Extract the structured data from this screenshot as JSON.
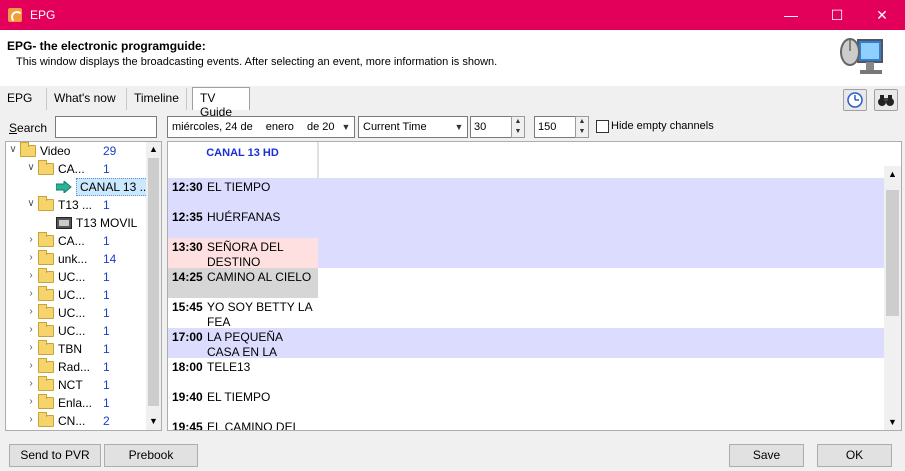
{
  "window": {
    "title": "EPG",
    "minimize": "—",
    "maximize": "☐",
    "close": "✕"
  },
  "header": {
    "title": "EPG- the electronic programguide:",
    "subtitle": "This window displays the broadcasting events. After selecting an event, more information is shown."
  },
  "tabs": [
    "EPG",
    "What's now",
    "Timeline",
    "TV Guide"
  ],
  "active_tab": "TV Guide",
  "toolbar": {
    "search_label": "Search",
    "search_value": "",
    "date_day": "miércoles, 24 de",
    "date_month": "enero",
    "date_year": "de 20",
    "time_mode": "Current Time",
    "spin1": "30",
    "spin2": "150",
    "hide_empty_label": "Hide empty channels"
  },
  "tree": [
    {
      "label": "Video",
      "count": "29",
      "level": 0,
      "icon": "folder-open-icon",
      "expanded": true
    },
    {
      "label": "CA...",
      "count": "1",
      "level": 1,
      "icon": "folder-open-icon",
      "expanded": true
    },
    {
      "label": "CANAL 13 ...",
      "count": "",
      "level": 2,
      "icon": "channel-arrow-icon",
      "selected": true
    },
    {
      "label": "T13 ...",
      "count": "1",
      "level": 1,
      "icon": "folder-open-icon",
      "expanded": true
    },
    {
      "label": "T13 MOVIL",
      "count": "",
      "level": 2,
      "icon": "film-icon"
    },
    {
      "label": "CA...",
      "count": "1",
      "level": 1,
      "icon": "folder-icon"
    },
    {
      "label": "unk...",
      "count": "14",
      "level": 1,
      "icon": "folder-icon"
    },
    {
      "label": "UC...",
      "count": "1",
      "level": 1,
      "icon": "folder-icon"
    },
    {
      "label": "UC...",
      "count": "1",
      "level": 1,
      "icon": "folder-icon"
    },
    {
      "label": "UC...",
      "count": "1",
      "level": 1,
      "icon": "folder-icon"
    },
    {
      "label": "UC...",
      "count": "1",
      "level": 1,
      "icon": "folder-icon"
    },
    {
      "label": "TBN",
      "count": "1",
      "level": 1,
      "icon": "folder-icon"
    },
    {
      "label": "Rad...",
      "count": "1",
      "level": 1,
      "icon": "folder-icon"
    },
    {
      "label": "NCT",
      "count": "1",
      "level": 1,
      "icon": "folder-icon"
    },
    {
      "label": "Enla...",
      "count": "1",
      "level": 1,
      "icon": "folder-icon"
    },
    {
      "label": "CN...",
      "count": "2",
      "level": 1,
      "icon": "folder-icon"
    }
  ],
  "guide": {
    "channel": "CANAL 13 HD",
    "events": [
      {
        "time": "12:30",
        "name": "EL TIEMPO",
        "state": "current"
      },
      {
        "time": "12:35",
        "name": "HUÉRFANAS",
        "state": "current"
      },
      {
        "time": "13:30",
        "name": "SEÑORA DEL DESTINO",
        "state": "highlight"
      },
      {
        "time": "14:25",
        "name": "CAMINO AL CIELO",
        "state": "selected"
      },
      {
        "time": "15:45",
        "name": "YO SOY BETTY LA FEA",
        "state": "normal"
      },
      {
        "time": "17:00",
        "name": "LA PEQUEÑA CASA EN LA PRADERA",
        "state": "current"
      },
      {
        "time": "18:00",
        "name": "TELE13",
        "state": "normal"
      },
      {
        "time": "19:40",
        "name": "EL TIEMPO",
        "state": "normal"
      },
      {
        "time": "19:45",
        "name": "EL CAMINO DEL",
        "state": "normal"
      }
    ]
  },
  "buttons": {
    "send_pvr": "Send to PVR",
    "prebook": "Prebook",
    "save": "Save",
    "ok": "OK"
  },
  "colors": {
    "titlebar": "#e2005a",
    "current_band": "#dcdcff",
    "highlight": "#ffe0e0",
    "selected": "#d6d6d6",
    "count": "#1a3ecf"
  }
}
